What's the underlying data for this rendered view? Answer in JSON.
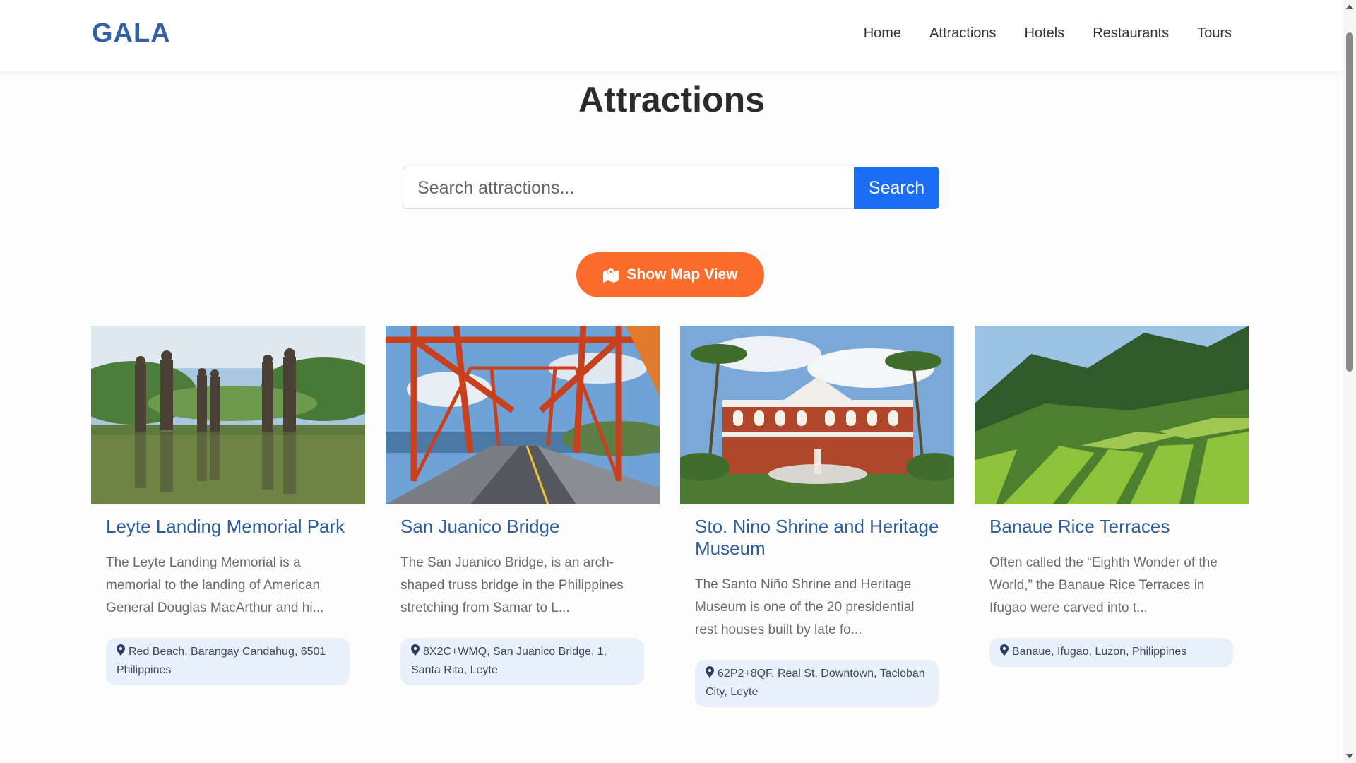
{
  "header": {
    "brand": "GALA",
    "nav": [
      "Home",
      "Attractions",
      "Hotels",
      "Restaurants",
      "Tours"
    ]
  },
  "main": {
    "title": "Attractions",
    "search": {
      "placeholder": "Search attractions...",
      "value": "",
      "button_label": "Search"
    },
    "map_button_label": "Show Map View",
    "cards": [
      {
        "title": "Leyte Landing Memorial Park",
        "description": "The Leyte Landing Memorial is a memorial to the landing of American General Douglas MacArthur and hi...",
        "location": "Red Beach, Barangay Candahug, 6501 Philippines"
      },
      {
        "title": "San Juanico Bridge",
        "description": "The San Juanico Bridge, is an arch-shaped truss bridge in the Philippines stretching from Samar to L...",
        "location": "8X2C+WMQ, San Juanico Bridge, 1, Santa Rita, Leyte"
      },
      {
        "title": "Sto. Nino Shrine and Heritage Museum",
        "description": "The Santo Niño Shrine and Heritage Museum is one of the 20 presidential rest houses built by late fo...",
        "location": "62P2+8QF, Real St, Downtown, Tacloban City, Leyte"
      },
      {
        "title": "Banaue Rice Terraces",
        "description": "Often called the “Eighth Wonder of the World,” the Banaue Rice Terraces in Ifugao were carved into t...",
        "location": "Banaue, Ifugao, Luzon, Philippines"
      }
    ]
  },
  "colors": {
    "brand": "#3560a6",
    "search_button": "#1a6ef5",
    "map_button": "#fb6b2b",
    "card_title": "#2e5d99",
    "location_badge_bg": "#e7f0fb"
  },
  "icons": {
    "map_button": "map-location-icon",
    "location": "map-pin-icon"
  }
}
